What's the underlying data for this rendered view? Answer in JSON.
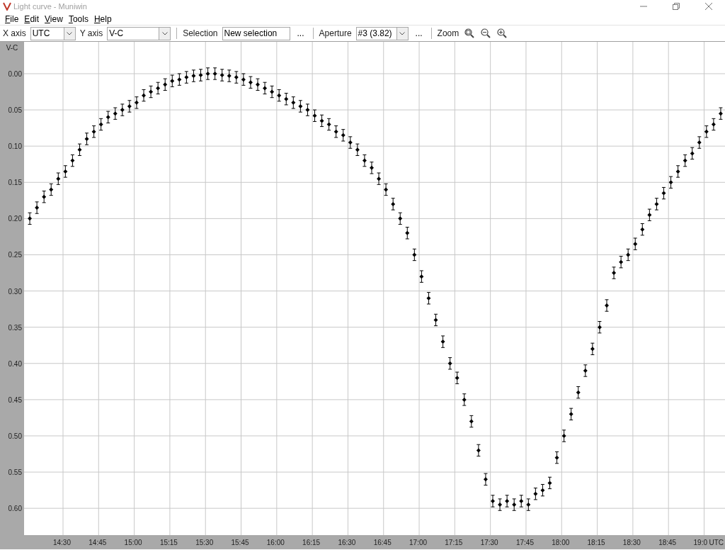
{
  "window": {
    "title": "Light curve - Muniwin"
  },
  "menu": [
    "File",
    "Edit",
    "View",
    "Tools",
    "Help"
  ],
  "toolbar": [
    {
      "kind": "combo",
      "label": "X axis",
      "value": "UTC"
    },
    {
      "kind": "combo",
      "label": "Y axis",
      "value": "V-C"
    },
    {
      "kind": "sep"
    },
    {
      "kind": "text",
      "label": "Selection",
      "value": "New selection",
      "more": "..."
    },
    {
      "kind": "sep"
    },
    {
      "kind": "combo",
      "label": "Aperture",
      "value": "#3 (3.82)",
      "more": "..."
    },
    {
      "kind": "sep"
    },
    {
      "kind": "zoom",
      "label": "Zoom"
    }
  ],
  "chart": {
    "chart_data": {
      "type": "scatter",
      "grid": true,
      "ylabel": "V-C",
      "xlabel": "UTC",
      "xlim": [
        853.6,
        1148.8
      ],
      "ylim": [
        0.637,
        -0.044
      ],
      "xticks": [
        {
          "value": 870,
          "label": "14:30"
        },
        {
          "value": 885,
          "label": "14:45"
        },
        {
          "value": 900,
          "label": "15:00"
        },
        {
          "value": 915,
          "label": "15:15"
        },
        {
          "value": 930,
          "label": "15:30"
        },
        {
          "value": 945,
          "label": "15:45"
        },
        {
          "value": 960,
          "label": "16:00"
        },
        {
          "value": 975,
          "label": "16:15"
        },
        {
          "value": 990,
          "label": "16:30"
        },
        {
          "value": 1005,
          "label": "16:45"
        },
        {
          "value": 1020,
          "label": "17:00"
        },
        {
          "value": 1035,
          "label": "17:15"
        },
        {
          "value": 1050,
          "label": "17:30"
        },
        {
          "value": 1065,
          "label": "17:45"
        },
        {
          "value": 1080,
          "label": "18:00"
        },
        {
          "value": 1095,
          "label": "18:15"
        },
        {
          "value": 1110,
          "label": "18:30"
        },
        {
          "value": 1125,
          "label": "18:45"
        },
        {
          "value": 1140,
          "label": "19:0"
        }
      ],
      "yticks": [
        {
          "value": 0,
          "label": "0.00"
        },
        {
          "value": 0.05,
          "label": "0.05"
        },
        {
          "value": 0.1,
          "label": "0.10"
        },
        {
          "value": 0.15,
          "label": "0.15"
        },
        {
          "value": 0.2,
          "label": "0.20"
        },
        {
          "value": 0.25,
          "label": "0.25"
        },
        {
          "value": 0.3,
          "label": "0.30"
        },
        {
          "value": 0.35,
          "label": "0.35"
        },
        {
          "value": 0.4,
          "label": "0.40"
        },
        {
          "value": 0.45,
          "label": "0.45"
        },
        {
          "value": 0.5,
          "label": "0.50"
        },
        {
          "value": 0.55,
          "label": "0.55"
        },
        {
          "value": 0.6,
          "label": "0.60"
        }
      ],
      "x": [
        856,
        859,
        862,
        865,
        868,
        871,
        874,
        877,
        880,
        883,
        886,
        889,
        892,
        895,
        898,
        901,
        904,
        907,
        910,
        913,
        916,
        919,
        922,
        925,
        928,
        931,
        934,
        937,
        940,
        943,
        946,
        949,
        952,
        955,
        958,
        961,
        964,
        967,
        970,
        973,
        976,
        979,
        982,
        985,
        988,
        991,
        994,
        997,
        1000,
        1003,
        1006,
        1009,
        1012,
        1015,
        1018,
        1021,
        1024,
        1027,
        1030,
        1033,
        1036,
        1039,
        1042,
        1045,
        1048,
        1051,
        1054,
        1057,
        1060,
        1063,
        1066,
        1069,
        1072,
        1075,
        1078,
        1081,
        1084,
        1087,
        1090,
        1093,
        1096,
        1099,
        1102,
        1105,
        1108,
        1111,
        1114,
        1117,
        1120,
        1123,
        1126,
        1129,
        1132,
        1135,
        1138,
        1141,
        1144,
        1147
      ],
      "series": [
        {
          "color": "#000000",
          "errors": [
            0.008,
            0.008,
            0.008,
            0.008,
            0.008,
            0.008,
            0.008,
            0.008,
            0.008,
            0.008,
            0.008,
            0.008,
            0.008,
            0.008,
            0.008,
            0.008,
            0.008,
            0.008,
            0.008,
            0.008,
            0.008,
            0.008,
            0.008,
            0.008,
            0.008,
            0.008,
            0.008,
            0.008,
            0.008,
            0.008,
            0.008,
            0.008,
            0.008,
            0.008,
            0.008,
            0.008,
            0.008,
            0.008,
            0.008,
            0.008,
            0.008,
            0.008,
            0.008,
            0.008,
            0.008,
            0.008,
            0.008,
            0.008,
            0.008,
            0.008,
            0.008,
            0.008,
            0.008,
            0.008,
            0.008,
            0.008,
            0.008,
            0.008,
            0.008,
            0.008,
            0.008,
            0.008,
            0.008,
            0.008,
            0.008,
            0.008,
            0.008,
            0.008,
            0.008,
            0.008,
            0.008,
            0.008,
            0.008,
            0.008,
            0.008,
            0.008,
            0.008,
            0.008,
            0.008,
            0.008,
            0.008,
            0.008,
            0.008,
            0.008,
            0.008,
            0.008,
            0.008,
            0.008,
            0.008,
            0.008,
            0.008,
            0.008,
            0.008,
            0.008,
            0.008,
            0.008,
            0.008,
            0.008
          ],
          "values": [
            0.2,
            0.185,
            0.17,
            0.16,
            0.145,
            0.135,
            0.12,
            0.105,
            0.09,
            0.08,
            0.07,
            0.06,
            0.055,
            0.05,
            0.045,
            0.04,
            0.03,
            0.025,
            0.02,
            0.015,
            0.01,
            0.008,
            0.005,
            0.003,
            0.002,
            0.0,
            0.0,
            0.002,
            0.003,
            0.005,
            0.008,
            0.012,
            0.015,
            0.02,
            0.025,
            0.03,
            0.035,
            0.04,
            0.045,
            0.05,
            0.058,
            0.065,
            0.07,
            0.08,
            0.085,
            0.095,
            0.105,
            0.12,
            0.13,
            0.145,
            0.16,
            0.18,
            0.2,
            0.22,
            0.25,
            0.28,
            0.31,
            0.34,
            0.37,
            0.4,
            0.42,
            0.45,
            0.48,
            0.52,
            0.56,
            0.59,
            0.595,
            0.59,
            0.595,
            0.59,
            0.595,
            0.58,
            0.575,
            0.565,
            0.53,
            0.5,
            0.47,
            0.44,
            0.41,
            0.38,
            0.35,
            0.32,
            0.275,
            0.26,
            0.25,
            0.235,
            0.215,
            0.195,
            0.18,
            0.165,
            0.15,
            0.135,
            0.12,
            0.11,
            0.095,
            0.08,
            0.07,
            0.055
          ]
        }
      ]
    }
  }
}
